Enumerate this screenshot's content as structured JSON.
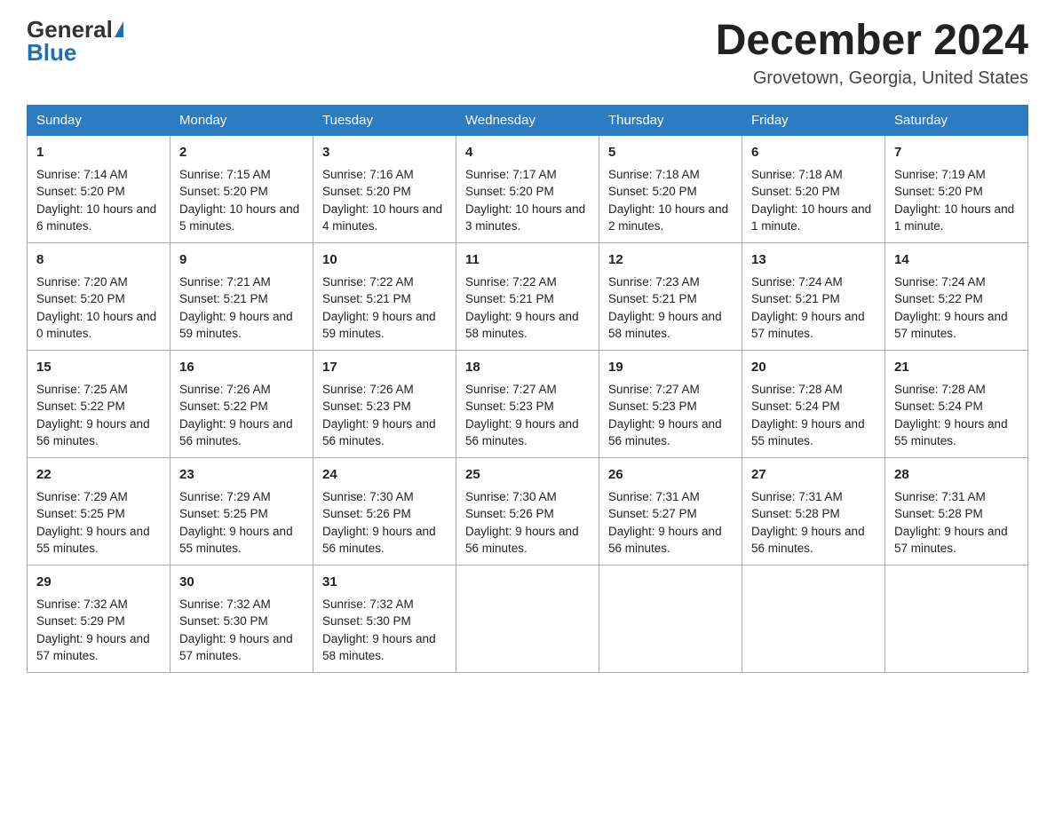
{
  "header": {
    "logo_general": "General",
    "logo_blue": "Blue",
    "month_title": "December 2024",
    "location": "Grovetown, Georgia, United States"
  },
  "days_of_week": [
    "Sunday",
    "Monday",
    "Tuesday",
    "Wednesday",
    "Thursday",
    "Friday",
    "Saturday"
  ],
  "weeks": [
    [
      {
        "day": "1",
        "sunrise": "7:14 AM",
        "sunset": "5:20 PM",
        "daylight": "10 hours and 6 minutes."
      },
      {
        "day": "2",
        "sunrise": "7:15 AM",
        "sunset": "5:20 PM",
        "daylight": "10 hours and 5 minutes."
      },
      {
        "day": "3",
        "sunrise": "7:16 AM",
        "sunset": "5:20 PM",
        "daylight": "10 hours and 4 minutes."
      },
      {
        "day": "4",
        "sunrise": "7:17 AM",
        "sunset": "5:20 PM",
        "daylight": "10 hours and 3 minutes."
      },
      {
        "day": "5",
        "sunrise": "7:18 AM",
        "sunset": "5:20 PM",
        "daylight": "10 hours and 2 minutes."
      },
      {
        "day": "6",
        "sunrise": "7:18 AM",
        "sunset": "5:20 PM",
        "daylight": "10 hours and 1 minute."
      },
      {
        "day": "7",
        "sunrise": "7:19 AM",
        "sunset": "5:20 PM",
        "daylight": "10 hours and 1 minute."
      }
    ],
    [
      {
        "day": "8",
        "sunrise": "7:20 AM",
        "sunset": "5:20 PM",
        "daylight": "10 hours and 0 minutes."
      },
      {
        "day": "9",
        "sunrise": "7:21 AM",
        "sunset": "5:21 PM",
        "daylight": "9 hours and 59 minutes."
      },
      {
        "day": "10",
        "sunrise": "7:22 AM",
        "sunset": "5:21 PM",
        "daylight": "9 hours and 59 minutes."
      },
      {
        "day": "11",
        "sunrise": "7:22 AM",
        "sunset": "5:21 PM",
        "daylight": "9 hours and 58 minutes."
      },
      {
        "day": "12",
        "sunrise": "7:23 AM",
        "sunset": "5:21 PM",
        "daylight": "9 hours and 58 minutes."
      },
      {
        "day": "13",
        "sunrise": "7:24 AM",
        "sunset": "5:21 PM",
        "daylight": "9 hours and 57 minutes."
      },
      {
        "day": "14",
        "sunrise": "7:24 AM",
        "sunset": "5:22 PM",
        "daylight": "9 hours and 57 minutes."
      }
    ],
    [
      {
        "day": "15",
        "sunrise": "7:25 AM",
        "sunset": "5:22 PM",
        "daylight": "9 hours and 56 minutes."
      },
      {
        "day": "16",
        "sunrise": "7:26 AM",
        "sunset": "5:22 PM",
        "daylight": "9 hours and 56 minutes."
      },
      {
        "day": "17",
        "sunrise": "7:26 AM",
        "sunset": "5:23 PM",
        "daylight": "9 hours and 56 minutes."
      },
      {
        "day": "18",
        "sunrise": "7:27 AM",
        "sunset": "5:23 PM",
        "daylight": "9 hours and 56 minutes."
      },
      {
        "day": "19",
        "sunrise": "7:27 AM",
        "sunset": "5:23 PM",
        "daylight": "9 hours and 56 minutes."
      },
      {
        "day": "20",
        "sunrise": "7:28 AM",
        "sunset": "5:24 PM",
        "daylight": "9 hours and 55 minutes."
      },
      {
        "day": "21",
        "sunrise": "7:28 AM",
        "sunset": "5:24 PM",
        "daylight": "9 hours and 55 minutes."
      }
    ],
    [
      {
        "day": "22",
        "sunrise": "7:29 AM",
        "sunset": "5:25 PM",
        "daylight": "9 hours and 55 minutes."
      },
      {
        "day": "23",
        "sunrise": "7:29 AM",
        "sunset": "5:25 PM",
        "daylight": "9 hours and 55 minutes."
      },
      {
        "day": "24",
        "sunrise": "7:30 AM",
        "sunset": "5:26 PM",
        "daylight": "9 hours and 56 minutes."
      },
      {
        "day": "25",
        "sunrise": "7:30 AM",
        "sunset": "5:26 PM",
        "daylight": "9 hours and 56 minutes."
      },
      {
        "day": "26",
        "sunrise": "7:31 AM",
        "sunset": "5:27 PM",
        "daylight": "9 hours and 56 minutes."
      },
      {
        "day": "27",
        "sunrise": "7:31 AM",
        "sunset": "5:28 PM",
        "daylight": "9 hours and 56 minutes."
      },
      {
        "day": "28",
        "sunrise": "7:31 AM",
        "sunset": "5:28 PM",
        "daylight": "9 hours and 57 minutes."
      }
    ],
    [
      {
        "day": "29",
        "sunrise": "7:32 AM",
        "sunset": "5:29 PM",
        "daylight": "9 hours and 57 minutes."
      },
      {
        "day": "30",
        "sunrise": "7:32 AM",
        "sunset": "5:30 PM",
        "daylight": "9 hours and 57 minutes."
      },
      {
        "day": "31",
        "sunrise": "7:32 AM",
        "sunset": "5:30 PM",
        "daylight": "9 hours and 58 minutes."
      },
      null,
      null,
      null,
      null
    ]
  ],
  "labels": {
    "sunrise": "Sunrise:",
    "sunset": "Sunset:",
    "daylight": "Daylight:"
  }
}
